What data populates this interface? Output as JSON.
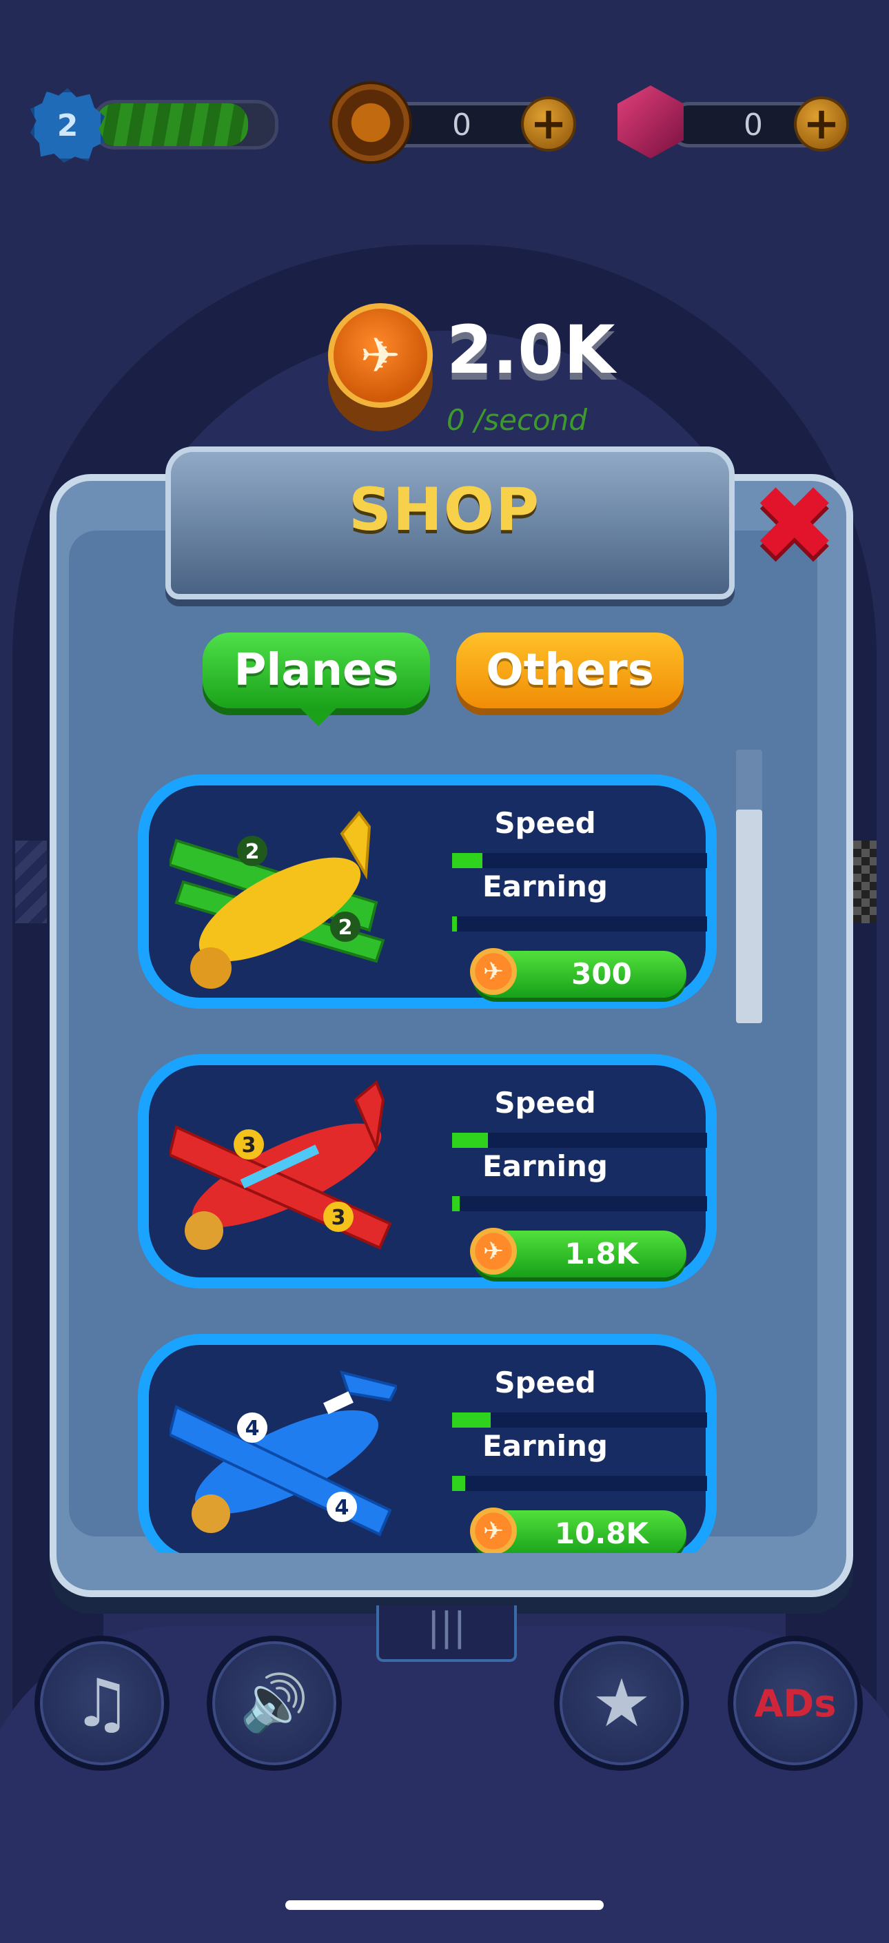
{
  "hud": {
    "level": "2",
    "xp_progress_percent": 85,
    "coins_count": "0",
    "gems_count": "0",
    "plus_symbol": "+"
  },
  "balance": {
    "amount": "2.0K",
    "rate": "0 /second"
  },
  "shop": {
    "title": "SHOP",
    "close_symbol": "✖",
    "tabs": [
      {
        "label": "Planes",
        "active": true
      },
      {
        "label": "Others",
        "active": false
      }
    ],
    "items": [
      {
        "plane_number": "2",
        "speed_label": "Speed",
        "earning_label": "Earning",
        "speed_percent": 12,
        "earning_percent": 2,
        "price": "300",
        "colors": [
          "#2fbf2b",
          "#f4c21a"
        ]
      },
      {
        "plane_number": "3",
        "speed_label": "Speed",
        "earning_label": "Earning",
        "speed_percent": 14,
        "earning_percent": 3,
        "price": "1.8K",
        "colors": [
          "#e22a2a",
          "#e6a020"
        ]
      },
      {
        "plane_number": "4",
        "speed_label": "Speed",
        "earning_label": "Earning",
        "speed_percent": 15,
        "earning_percent": 5,
        "price": "10.8K",
        "colors": [
          "#1f7df0",
          "#e6a020"
        ]
      }
    ]
  },
  "bottom_bar": {
    "music_icon": "♫",
    "sound_icon": "🔊",
    "rate_icon": "★",
    "no_ads_label": "ADs"
  },
  "theme": {
    "accent_green": "#2fd21c",
    "card_border": "#1aa4ff",
    "title_yellow": "#f7d14a"
  }
}
